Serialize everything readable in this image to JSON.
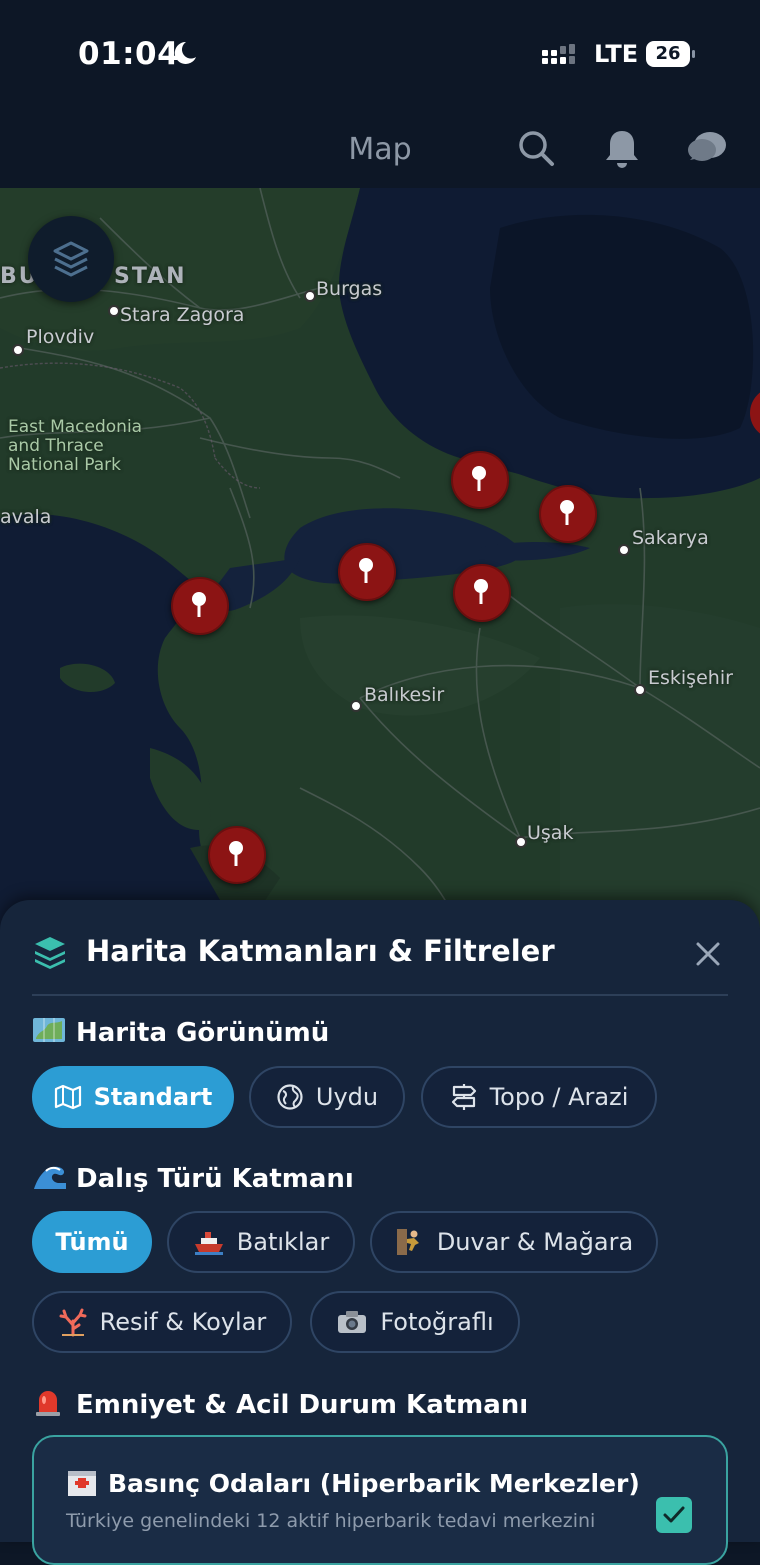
{
  "status_bar": {
    "time": "01:04",
    "network": "LTE",
    "battery": "26"
  },
  "header": {
    "title": "Map"
  },
  "map": {
    "labels": {
      "bulgaria_left": "BU",
      "bulgaria_right": "STAN",
      "burgas": "Burgas",
      "stara_zagora": "Stara Zagora",
      "plovdiv": "Plovdiv",
      "park": "East Macedonia\nand Thrace\nNational Park",
      "kavala": "avala",
      "sakarya": "Sakarya",
      "balikesir": "Balıkesir",
      "eskisehir": "Eskişehir",
      "usak": "Uşak"
    }
  },
  "sheet": {
    "title": "Harita Katmanları & Filtreler",
    "map_view": {
      "title": "Harita Görünümü",
      "options": [
        "Standart",
        "Uydu",
        "Topo / Arazi"
      ],
      "selected": "Standart"
    },
    "dive_type": {
      "title": "Dalış Türü Katmanı",
      "options": [
        "Tümü",
        "Batıklar",
        "Duvar & Mağara",
        "Resif & Koylar",
        "Fotoğraflı"
      ],
      "selected": "Tümü"
    },
    "safety": {
      "title": "Emniyet & Acil Durum Katmanı",
      "card_title": "Basınç Odaları (Hiperbarik Merkezler)",
      "card_desc": "Türkiye genelindeki 12 aktif hiperbarik tedavi merkezini",
      "checked": true
    }
  },
  "colors": {
    "accent": "#2c9dd4",
    "pin": "#8c1414",
    "check": "#3bbfae"
  }
}
